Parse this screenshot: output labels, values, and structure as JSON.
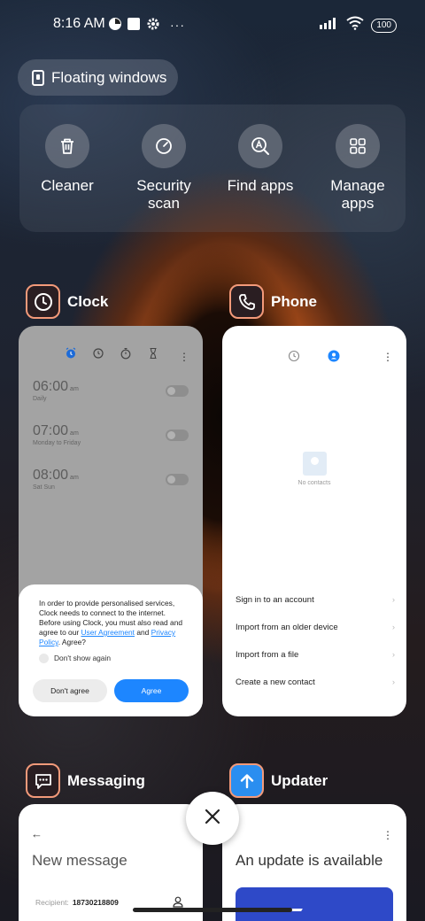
{
  "status_bar": {
    "time": "8:16 AM",
    "battery": "100"
  },
  "floating_windows": {
    "label": "Floating windows"
  },
  "quick_actions": [
    {
      "label": "Cleaner",
      "icon": "trash-icon"
    },
    {
      "label": "Security\nscan",
      "icon": "security-scan-icon"
    },
    {
      "label": "Find apps",
      "icon": "find-apps-icon"
    },
    {
      "label": "Manage\napps",
      "icon": "manage-apps-icon"
    }
  ],
  "recent_apps": [
    {
      "name": "Clock",
      "icon": "clock-icon"
    },
    {
      "name": "Phone",
      "icon": "phone-icon"
    },
    {
      "name": "Messaging",
      "icon": "messaging-icon"
    },
    {
      "name": "Updater",
      "icon": "updater-icon"
    }
  ],
  "clock_card": {
    "alarms": [
      {
        "time": "06:00",
        "ampm": "am",
        "label": "Daily"
      },
      {
        "time": "07:00",
        "ampm": "am",
        "label": "Monday to Friday"
      },
      {
        "time": "08:00",
        "ampm": "am",
        "label": "Sat Sun"
      }
    ],
    "dialog": {
      "text_1": "In order to provide personalised services, Clock needs to connect to the internet. Before using Clock, you must also read and agree to our ",
      "link_1": "User Agreement",
      "text_2": " and ",
      "link_2": "Privacy Policy",
      "text_3": ". Agree?",
      "dont_show": "Don't show again",
      "disagree": "Don't agree",
      "agree": "Agree"
    }
  },
  "phone_card": {
    "empty_text": "No contacts",
    "options": [
      "Sign in to an account",
      "Import from an older device",
      "Import from a file",
      "Create a new contact"
    ]
  },
  "messaging_card": {
    "title": "New message",
    "recipient_label": "Recipient:",
    "recipient_value": "18730218809"
  },
  "updater_card": {
    "title": "An update is available"
  },
  "colors": {
    "accent_blue": "#1d86ff",
    "icon_border": "#f39a7a"
  }
}
